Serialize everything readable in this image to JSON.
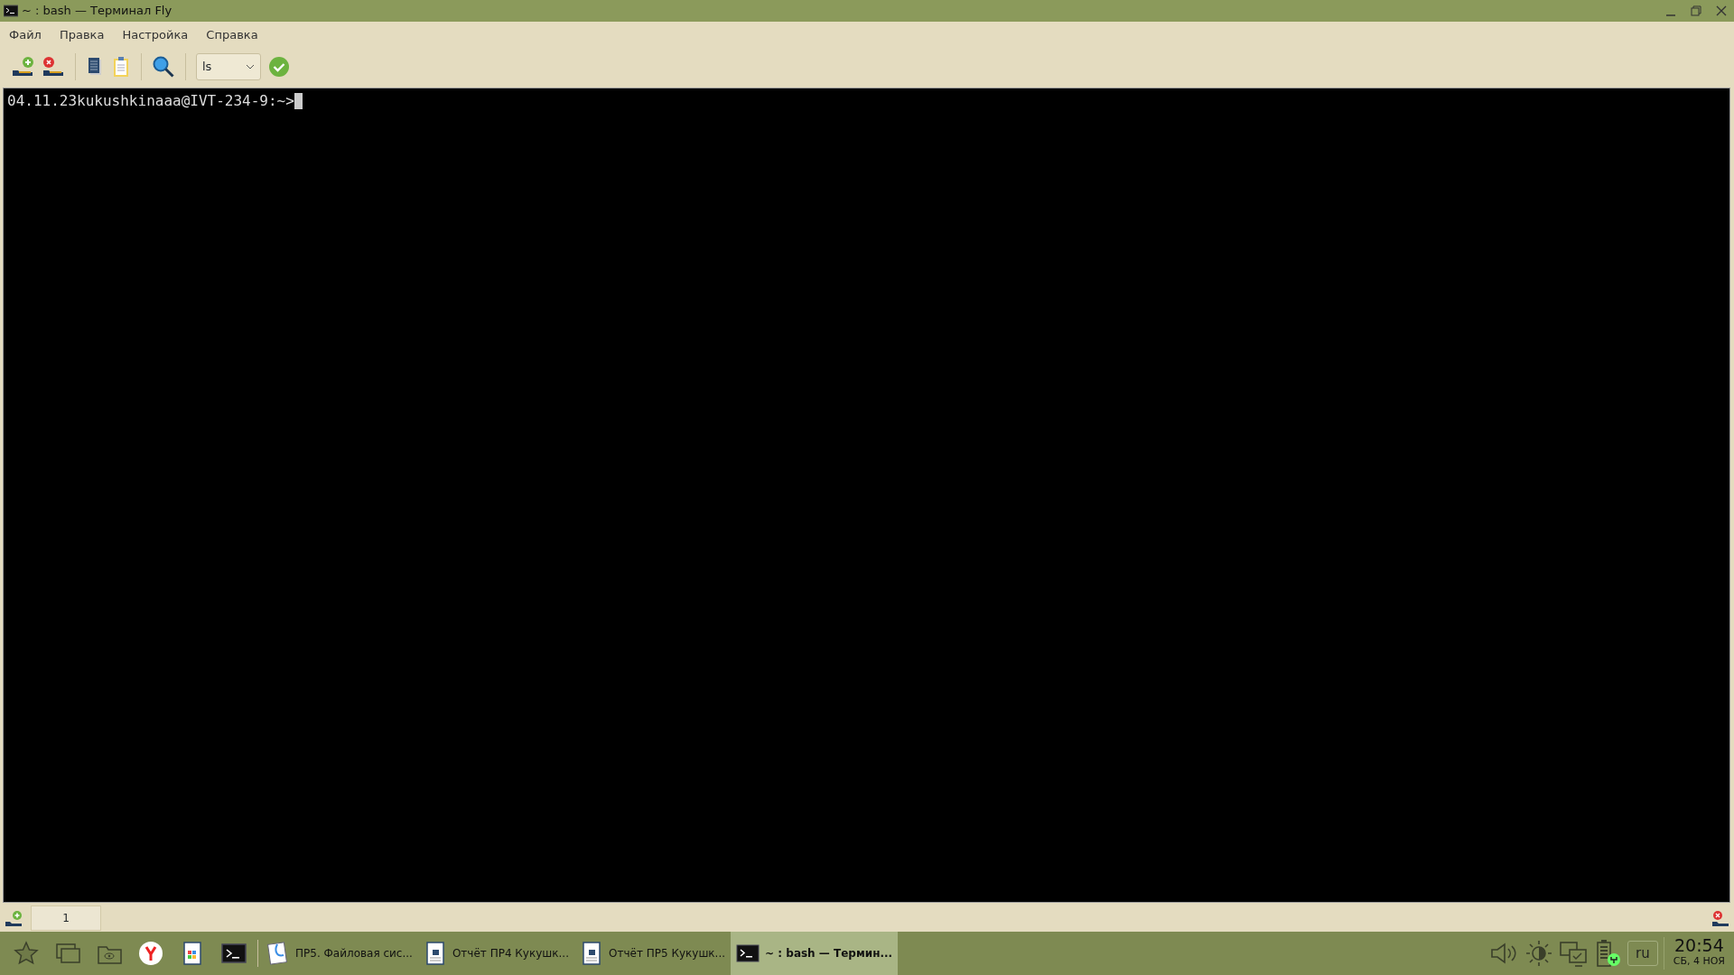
{
  "window": {
    "title": "~ : bash — Терминал Fly"
  },
  "menu": [
    "Файл",
    "Правка",
    "Настройка",
    "Справка"
  ],
  "toolbar": {
    "command": {
      "value": "ls"
    }
  },
  "terminal": {
    "lines": [
      "04.11.23kukushkinaaa@IVT-234-9:~>"
    ]
  },
  "session_tabs": [
    {
      "label": "1",
      "selected": true
    }
  ],
  "taskbar": {
    "tasks": [
      {
        "label": "ПР5. Файловая сис...",
        "kind": "reader",
        "selected": false
      },
      {
        "label": "Отчёт ПР4 Кукушк...",
        "kind": "document",
        "selected": false
      },
      {
        "label": "Отчёт ПР5 Кукушк...",
        "kind": "document",
        "selected": false
      },
      {
        "label": "~ : bash — Термин...",
        "kind": "terminal",
        "selected": true
      }
    ],
    "language": "ru",
    "time": "20:54",
    "date": "СБ, 4 НОЯ"
  }
}
